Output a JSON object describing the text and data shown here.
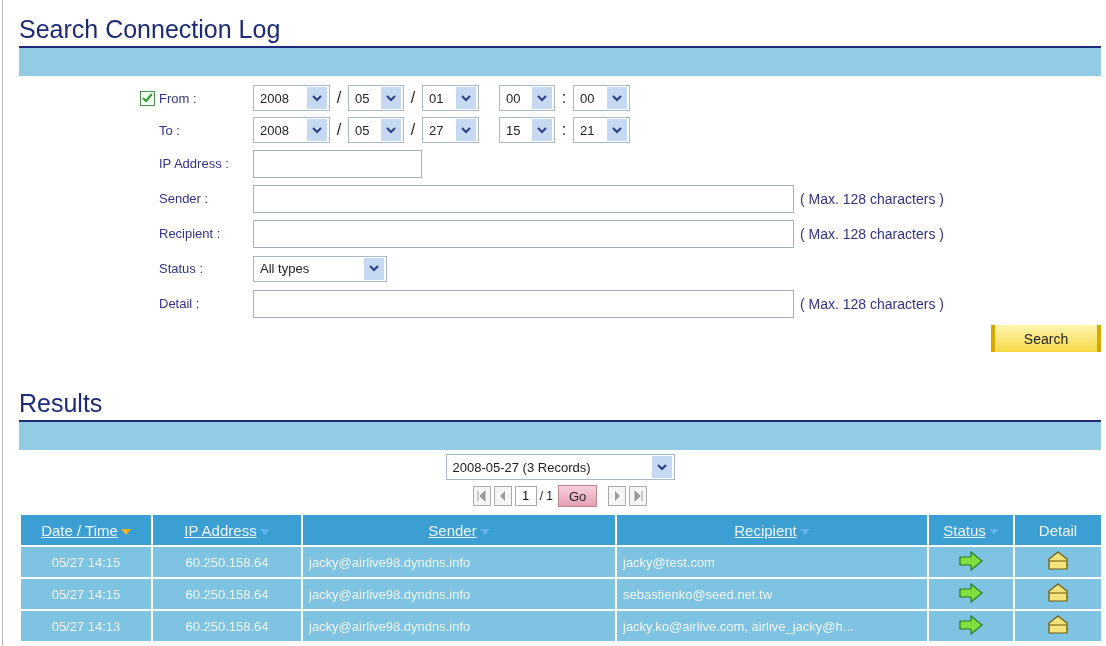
{
  "search_section": {
    "title": "Search Connection Log",
    "date_filter": {
      "checked": true,
      "from": {
        "label": "From :",
        "year": "2008",
        "month": "05",
        "day": "01",
        "hour": "00",
        "minute": "00"
      },
      "to": {
        "label": "To :",
        "year": "2008",
        "month": "05",
        "day": "27",
        "hour": "15",
        "minute": "21"
      },
      "date_separator": "/",
      "time_separator": ":"
    },
    "fields": [
      {
        "kind": "short",
        "label": "IP Address :"
      },
      {
        "kind": "text",
        "label": "Sender :",
        "hint": "( Max. 128 characters )"
      },
      {
        "kind": "text",
        "label": "Recipient :",
        "hint": "( Max. 128 characters )"
      },
      {
        "kind": "select",
        "label": "Status :",
        "value": "All types"
      },
      {
        "kind": "text",
        "label": "Detail :",
        "hint": "( Max. 128 characters )"
      }
    ],
    "search_button": "Search"
  },
  "results_section": {
    "title": "Results",
    "day_select": "2008-05-27 (3 Records)",
    "pager": {
      "page": "1",
      "total": "/ 1",
      "go": "Go"
    },
    "columns": [
      {
        "label": "Date / Time",
        "link": true,
        "sorted": true
      },
      {
        "label": "IP Address",
        "link": true,
        "sorted": false
      },
      {
        "label": "Sender",
        "link": true,
        "sorted": false
      },
      {
        "label": "Recipient",
        "link": true,
        "sorted": false
      },
      {
        "label": "Status",
        "link": true,
        "sorted": false
      },
      {
        "label": "Detail",
        "link": false,
        "sorted": false
      }
    ],
    "rows": [
      {
        "date_time": "05/27 14:15",
        "ip_address": "60.250.158.64",
        "sender": "jacky@airlive98.dyndns.info",
        "recipient": "jacky@test.com"
      },
      {
        "date_time": "05/27 14:15",
        "ip_address": "60.250.158.64",
        "sender": "jacky@airlive98.dyndns.info",
        "recipient": "sebastienko@seed.net.tw"
      },
      {
        "date_time": "05/27 14:13",
        "ip_address": "60.250.158.64",
        "sender": "jacky@airlive98.dyndns.info",
        "recipient": "jacky.ko@airlive.com, airlive_jacky@h..."
      }
    ]
  }
}
